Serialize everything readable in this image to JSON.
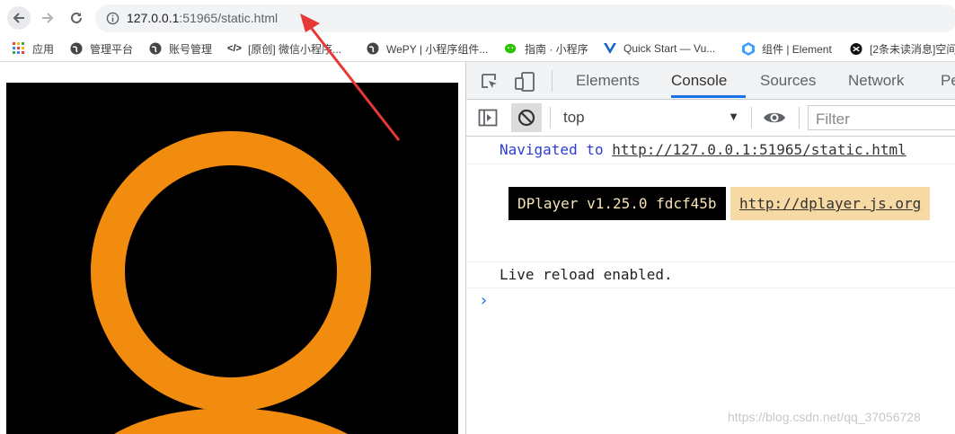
{
  "browser": {
    "url_host": "127.0.0.1",
    "url_rest": ":51965/static.html"
  },
  "bookmarks": [
    {
      "label": "应用",
      "icon": "apps-grid-icon"
    },
    {
      "label": "管理平台",
      "icon": "globe-icon"
    },
    {
      "label": "账号管理",
      "icon": "globe-icon"
    },
    {
      "label": "[原创] 微信小程序...",
      "icon": "code-icon"
    },
    {
      "label": "WePY | 小程序组件...",
      "icon": "globe-icon"
    },
    {
      "label": "指南 · 小程序",
      "icon": "wechat-icon"
    },
    {
      "label": "Quick Start — Vu...",
      "icon": "vue-icon"
    },
    {
      "label": "组件 | Element",
      "icon": "element-icon"
    },
    {
      "label": "[2条未读消息]空间",
      "icon": "blog-icon"
    }
  ],
  "devtools": {
    "tabs": [
      "Elements",
      "Console",
      "Sources",
      "Network",
      "Pe"
    ],
    "active_tab": "Console",
    "context": "top",
    "filter_placeholder": "Filter",
    "console": {
      "nav_prefix": "Navigated to ",
      "nav_url": "http://127.0.0.1:51965/static.html",
      "dplayer_version": "DPlayer v1.25.0 fdcf45b",
      "dplayer_link": "http://dplayer.js.org",
      "live_reload": "Live reload enabled.",
      "prompt": "›"
    }
  },
  "watermark": "https://blog.csdn.net/qq_37056728",
  "colors": {
    "logo_orange": "#f28c0f",
    "active_tab_underline": "#1a73e8",
    "annotation_arrow": "#e53935"
  }
}
